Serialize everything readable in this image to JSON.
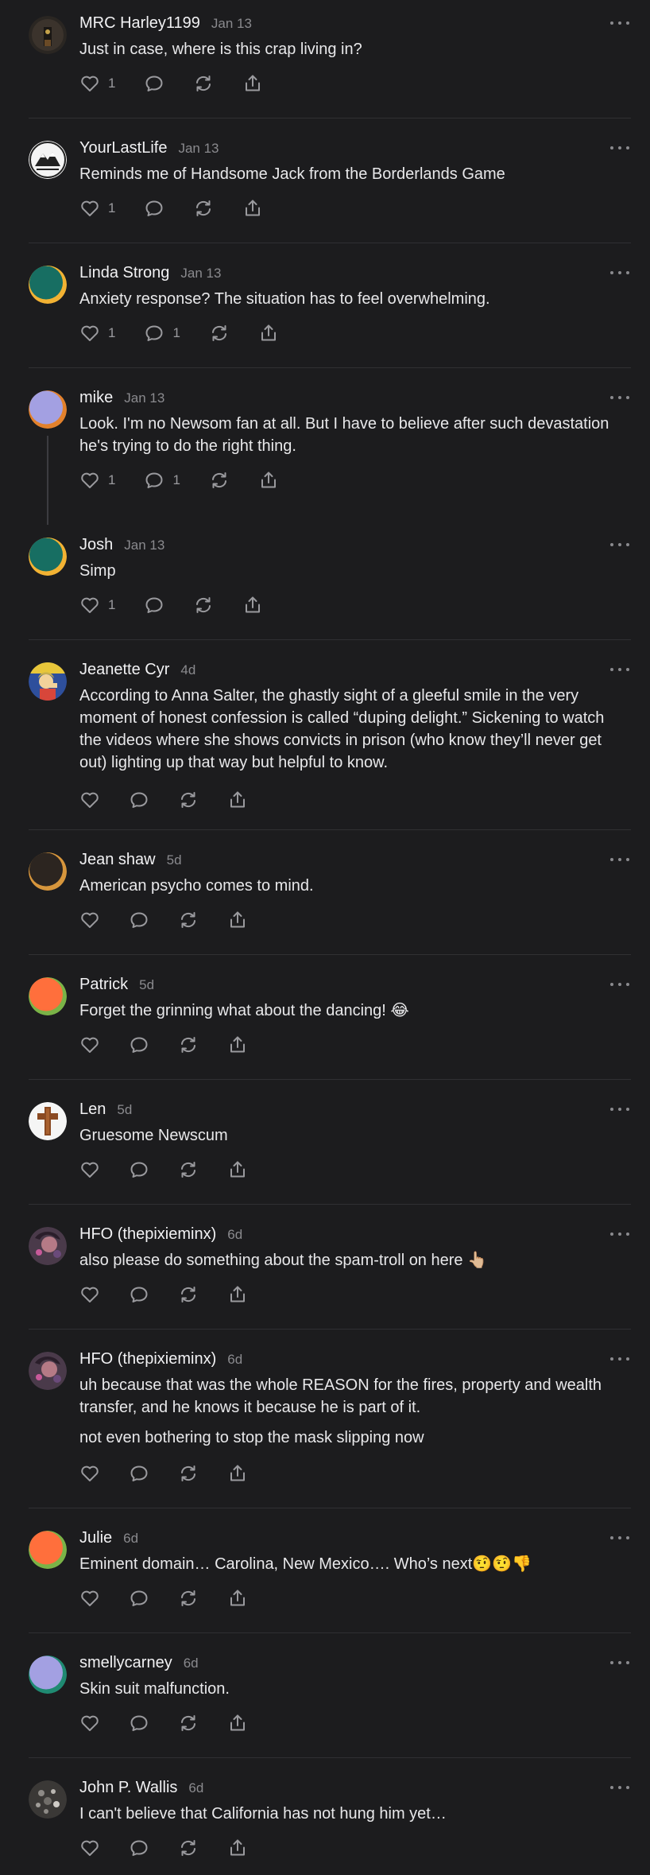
{
  "comments": [
    {
      "author": "MRC Harley1199",
      "date": "Jan 13",
      "text": [
        "Just in case, where is this crap living in?"
      ],
      "likes": "1",
      "replies": "",
      "avatar": "photo-dark"
    },
    {
      "author": "YourLastLife",
      "date": "Jan 13",
      "text": [
        "Reminds me of Handsome Jack from the Borderlands Game"
      ],
      "likes": "1",
      "replies": "",
      "avatar": "photo-mountain"
    },
    {
      "author": "Linda Strong",
      "date": "Jan 13",
      "text": [
        "Anxiety response? The situation has to feel overwhelming."
      ],
      "likes": "1",
      "replies": "1",
      "avatar": "teal-yellow"
    },
    {
      "author": "mike",
      "date": "Jan 13",
      "text": [
        "Look. I'm no Newsom fan at all. But I have to believe after such devastation he's trying to do the right thing."
      ],
      "likes": "1",
      "replies": "1",
      "avatar": "lavender-orange"
    },
    {
      "author": "Josh",
      "date": "Jan 13",
      "text": [
        "Simp"
      ],
      "likes": "1",
      "replies": "",
      "avatar": "teal-yellow"
    },
    {
      "author": "Jeanette Cyr",
      "date": "4d",
      "text": [
        "According to Anna Salter, the ghastly sight of a gleeful smile in the very moment of honest confession is called “duping delight.” Sickening to watch the videos where she shows convicts in prison (who know they’ll never get out) lighting up that way but helpful to know."
      ],
      "likes": "",
      "replies": "",
      "avatar": "photo-poster"
    },
    {
      "author": "Jean shaw",
      "date": "5d",
      "text": [
        "American psycho comes to mind."
      ],
      "likes": "",
      "replies": "",
      "avatar": "dark-orange"
    },
    {
      "author": "Patrick",
      "date": "5d",
      "text": [
        "Forget the grinning what about the dancing! 😂"
      ],
      "likes": "",
      "replies": "",
      "avatar": "orange-green"
    },
    {
      "author": "Len",
      "date": "5d",
      "text": [
        "Gruesome Newscum"
      ],
      "likes": "",
      "replies": "",
      "avatar": "photo-cross"
    },
    {
      "author": "HFO (thepixieminx)",
      "date": "6d",
      "text": [
        "also please do something about the spam-troll on here 👆🏼"
      ],
      "likes": "",
      "replies": "",
      "avatar": "photo-pixie"
    },
    {
      "author": "HFO (thepixieminx)",
      "date": "6d",
      "text": [
        "uh because that was the whole REASON for the fires, property and wealth transfer, and he knows it because he is part of it.",
        "not even bothering to stop the mask slipping now"
      ],
      "likes": "",
      "replies": "",
      "avatar": "photo-pixie"
    },
    {
      "author": "Julie",
      "date": "6d",
      "text": [
        "Eminent domain… Carolina, New Mexico…. Who’s next🤨🤨👎"
      ],
      "likes": "",
      "replies": "",
      "avatar": "orange-green"
    },
    {
      "author": "smellycarney",
      "date": "6d",
      "text": [
        "Skin suit malfunction."
      ],
      "likes": "",
      "replies": "",
      "avatar": "lavender-green"
    },
    {
      "author": "John P. Wallis",
      "date": "6d",
      "text": [
        "I can't believe that California has not hung him yet…"
      ],
      "likes": "",
      "replies": "",
      "avatar": "photo-sparkle"
    }
  ]
}
